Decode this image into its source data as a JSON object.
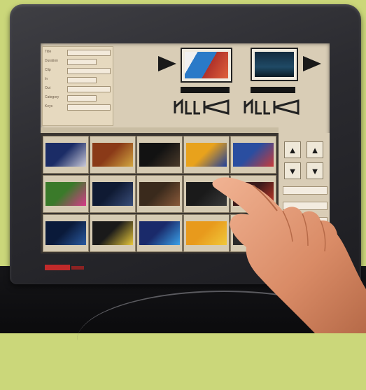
{
  "monitor": {
    "brand_badge": "",
    "accent_color": "#c12a2a"
  },
  "info_panel": {
    "rows": [
      {
        "label": "Title",
        "value": ""
      },
      {
        "label": "Duration",
        "value": ""
      },
      {
        "label": "Clip",
        "value": ""
      },
      {
        "label": "In",
        "value": ""
      },
      {
        "label": "Out",
        "value": ""
      },
      {
        "label": "Category",
        "value": ""
      },
      {
        "label": "Keys",
        "value": ""
      }
    ]
  },
  "preview": {
    "left_label": "",
    "right_label": "",
    "logo_left": "ꟷ",
    "logo_right": "ꟷ"
  },
  "grid": {
    "header": "",
    "clips": [
      {
        "tc": "",
        "caption": "",
        "colors": [
          "#1b2c66",
          "#c9c9d8"
        ]
      },
      {
        "tc": "",
        "caption": "",
        "colors": [
          "#8a3a18",
          "#d2a640"
        ]
      },
      {
        "tc": "",
        "caption": "",
        "colors": [
          "#121212",
          "#4a3a2a"
        ]
      },
      {
        "tc": "",
        "caption": "",
        "colors": [
          "#e8a21c",
          "#1f3f9a"
        ]
      },
      {
        "tc": "",
        "caption": "",
        "colors": [
          "#2a4ea0",
          "#c83a3a"
        ]
      },
      {
        "tc": "",
        "caption": "",
        "colors": [
          "#3a7a2a",
          "#d83a8a"
        ]
      },
      {
        "tc": "",
        "caption": "",
        "colors": [
          "#0f1a33",
          "#3a4e7a"
        ]
      },
      {
        "tc": "",
        "caption": "",
        "colors": [
          "#3a2a1c",
          "#8a5a3a"
        ]
      },
      {
        "tc": "",
        "caption": "",
        "colors": [
          "#1a1a1a",
          "#3a3a3a"
        ]
      },
      {
        "tc": "",
        "caption": "",
        "colors": [
          "#3a1a1a",
          "#c83a2a"
        ]
      },
      {
        "tc": "",
        "caption": "",
        "colors": [
          "#0a1a3a",
          "#2a5aa0"
        ]
      },
      {
        "tc": "",
        "caption": "",
        "colors": [
          "#1a1a1a",
          "#e8c83a"
        ]
      },
      {
        "tc": "",
        "caption": "",
        "colors": [
          "#1a2a6a",
          "#3aa0e8"
        ]
      },
      {
        "tc": "",
        "caption": "",
        "colors": [
          "#e89a1c",
          "#f0c83a"
        ]
      },
      {
        "tc": "",
        "caption": "",
        "colors": [
          "#2a2a2a",
          "#4a4a4a"
        ]
      }
    ]
  },
  "side_panel": {
    "buttons": [
      "▲",
      "▲",
      "▼",
      "▼"
    ],
    "bars": [
      "",
      "",
      "",
      ""
    ]
  }
}
